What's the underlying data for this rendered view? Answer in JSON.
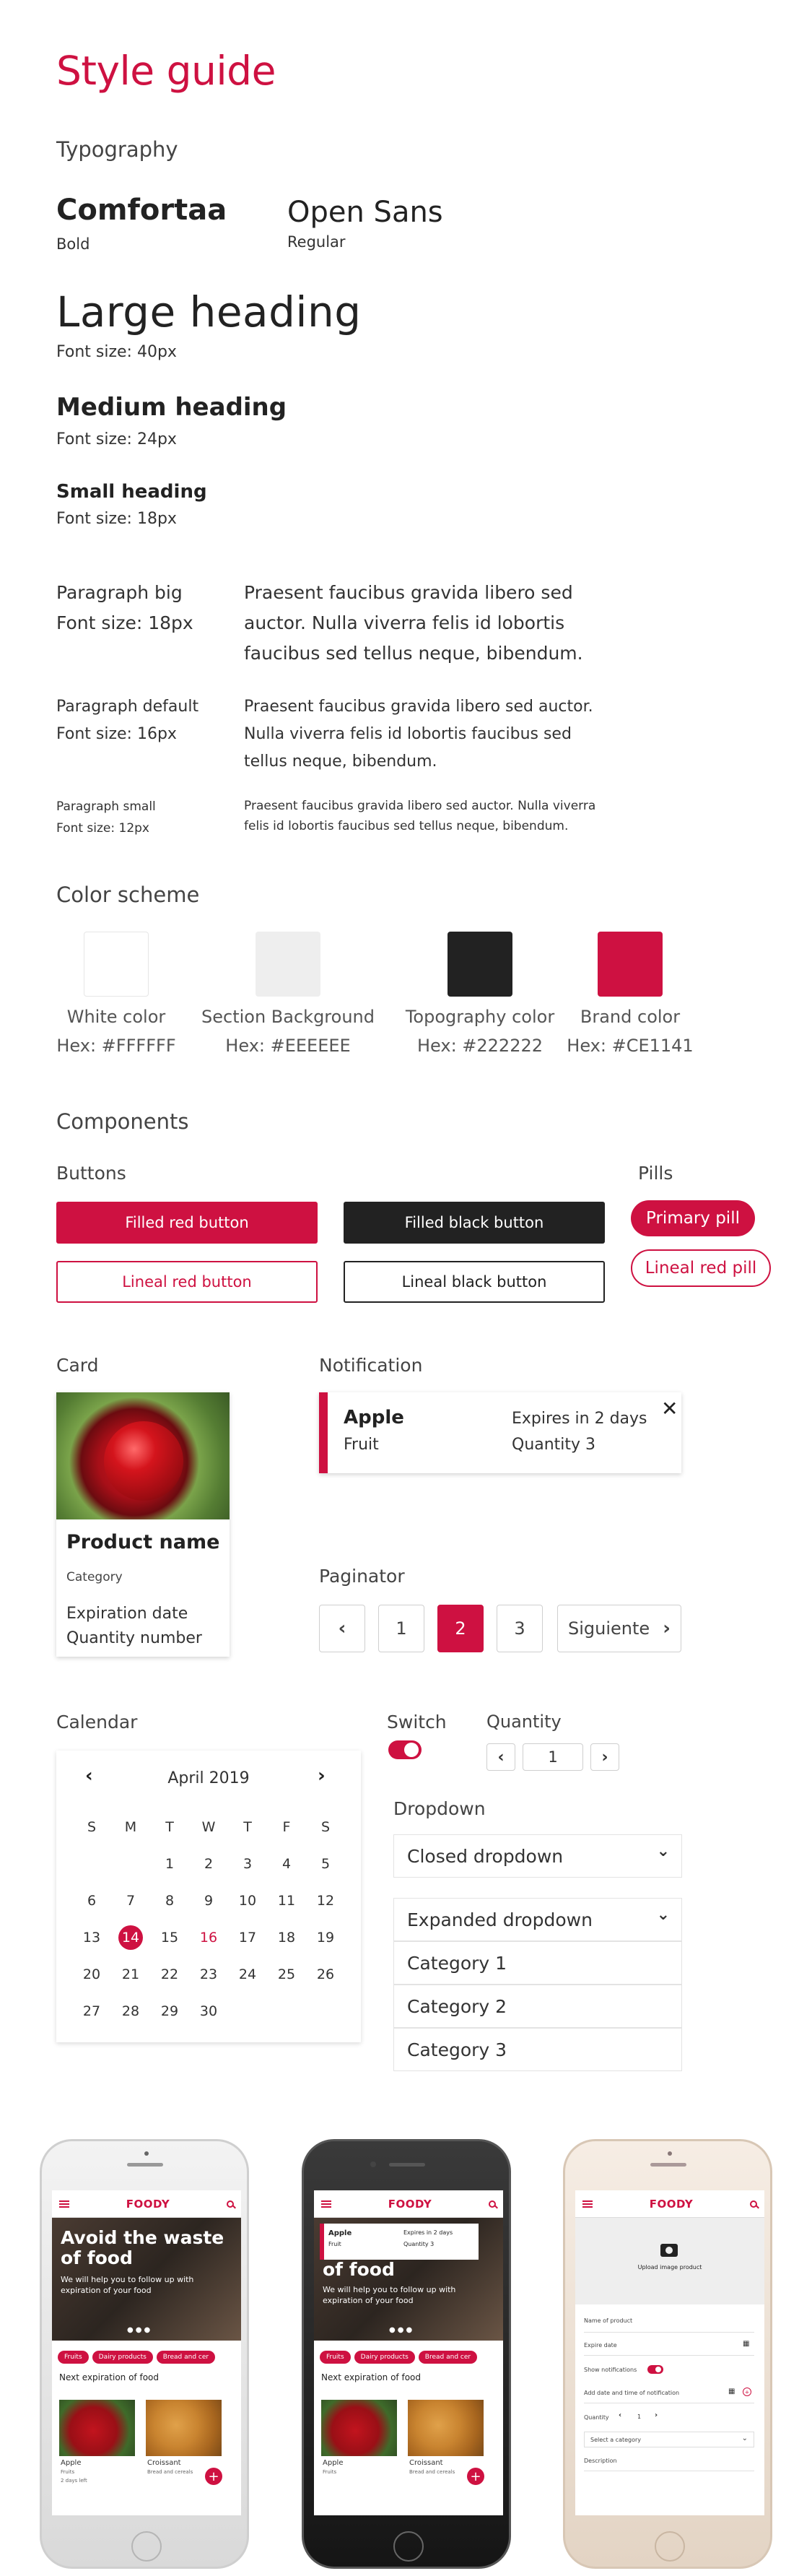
{
  "title": "Style guide",
  "typography": {
    "heading": "Typography",
    "font1": {
      "name": "Comfortaa",
      "weight": "Bold"
    },
    "font2": {
      "name": "Open Sans",
      "weight": "Regular"
    },
    "large": {
      "label": "Large heading",
      "size": "Font size: 40px"
    },
    "medium": {
      "label": "Medium heading",
      "size": "Font size: 24px"
    },
    "small": {
      "label": "Small heading",
      "size": "Font size: 18px"
    },
    "para_big": {
      "label": "Paragraph big",
      "size": "Font size: 18px",
      "sample": "Praesent faucibus gravida libero sed auctor. Nulla viverra felis id lobortis faucibus sed tellus neque, bibendum."
    },
    "para_default": {
      "label": "Paragraph default",
      "size": "Font size: 16px",
      "sample": "Praesent faucibus gravida libero sed auctor. Nulla viverra felis id lobortis faucibus sed tellus neque, bibendum."
    },
    "para_small": {
      "label": "Paragraph small",
      "size": "Font size: 12px",
      "sample": "Praesent faucibus gravida libero sed auctor. Nulla viverra felis id lobortis faucibus sed tellus neque, bibendum."
    }
  },
  "colors": {
    "heading": "Color scheme",
    "items": [
      {
        "name": "White color",
        "hex": "Hex: #FFFFFF",
        "value": "#FFFFFF"
      },
      {
        "name": "Section Background",
        "hex": "Hex: #EEEEEE",
        "value": "#EEEEEE"
      },
      {
        "name": "Topography color",
        "hex": "Hex: #222222",
        "value": "#222222"
      },
      {
        "name": "Brand color",
        "hex": "Hex: #CE1141",
        "value": "#CE1141"
      }
    ]
  },
  "components": {
    "heading": "Components",
    "buttons_heading": "Buttons",
    "pills_heading": "Pills",
    "filled_red": "Filled red button",
    "filled_black": "Filled black button",
    "lineal_red": "Lineal red button",
    "lineal_black": "Lineal black button",
    "primary_pill": "Primary pill",
    "lineal_pill": "Lineal red pill"
  },
  "card": {
    "heading": "Card",
    "product_name": "Product name",
    "category": "Category",
    "expiration": "Expiration date",
    "quantity": "Quantity number"
  },
  "notification": {
    "heading": "Notification",
    "title": "Apple",
    "subtitle": "Fruit",
    "expires": "Expires in 2 days",
    "quantity": "Quantity 3",
    "close_icon": "close-icon"
  },
  "paginator": {
    "heading": "Paginator",
    "pages": [
      "1",
      "2",
      "3"
    ],
    "active": "2",
    "next": "Siguiente"
  },
  "calendar": {
    "heading": "Calendar",
    "month": "April 2019",
    "weekdays": [
      "S",
      "M",
      "T",
      "W",
      "T",
      "F",
      "S"
    ],
    "days": [
      "",
      "",
      "1",
      "2",
      "3",
      "4",
      "5",
      "6",
      "7",
      "8",
      "9",
      "10",
      "11",
      "12",
      "13",
      "14",
      "15",
      "16",
      "17",
      "18",
      "19",
      "20",
      "21",
      "22",
      "23",
      "24",
      "25",
      "26",
      "27",
      "28",
      "29",
      "30"
    ],
    "selected": "14",
    "highlighted": "16"
  },
  "switch": {
    "heading": "Switch"
  },
  "quantity": {
    "heading": "Quantity",
    "value": "1"
  },
  "dropdown": {
    "heading": "Dropdown",
    "closed": "Closed dropdown",
    "expanded": "Expanded dropdown",
    "options": [
      "Category 1",
      "Category 2",
      "Category 3"
    ]
  },
  "phones": {
    "brand": "FOODY",
    "hero_title": "Avoid the waste of food",
    "hero_text": "We will help you to follow up with expiration of your food",
    "hero_title_partial": "of food",
    "pills": [
      "Fruits",
      "Dairy products",
      "Bread and cer"
    ],
    "next_expiration": "Next expiration of food",
    "item1": {
      "name": "Apple",
      "category": "Fruits",
      "extra": "2 days left"
    },
    "item2": {
      "name": "Croissant",
      "category": "Bread and cereals"
    },
    "notif": {
      "title": "Apple",
      "sub": "Fruit",
      "expires": "Expires in 2 days",
      "qty": "Quantity 3"
    },
    "upload": "Upload image product",
    "form": {
      "name": "Name of product",
      "expire": "Expire date",
      "show": "Show notifications",
      "notif_date": "Add date and time of notification",
      "quantity": "Quantity",
      "qty_value": "1",
      "select": "Select a category",
      "description": "Description"
    }
  }
}
